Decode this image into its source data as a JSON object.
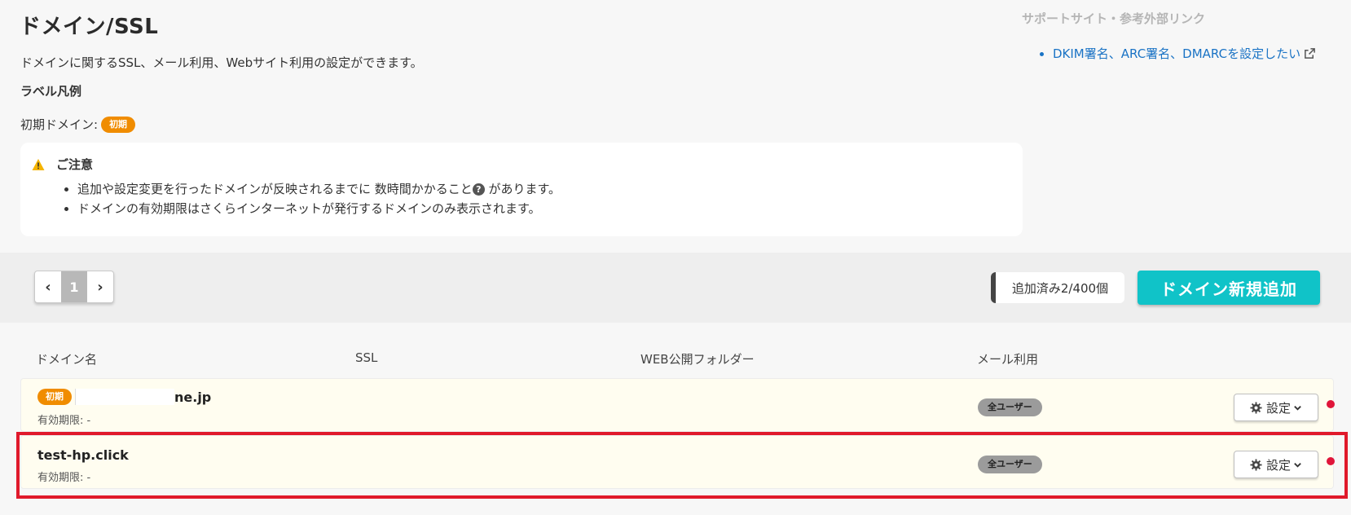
{
  "page": {
    "title": "ドメイン/SSL",
    "description": "ドメインに関するSSL、メール利用、Webサイト利用の設定ができます。",
    "legend_title": "ラベル凡例",
    "legend_label": "初期ドメイン:",
    "legend_badge": "初期"
  },
  "notice": {
    "icon": "warning-icon",
    "title": "ご注意",
    "item1_text": "追加や設定変更を行ったドメインが反映されるまでに 数時間かかること",
    "item1_suffix": " があります。",
    "item2_text": "ドメインの有効期限はさくらインターネットが発行するドメインのみ表示されます。"
  },
  "support": {
    "title": "サポートサイト・参考外部リンク",
    "link1": "DKIM署名、ARC署名、DMARCを設定したい"
  },
  "toolbar": {
    "prev": "‹",
    "page": "1",
    "next": "›",
    "count": "追加済み2/400個",
    "add_button": "ドメイン新規追加"
  },
  "table": {
    "headers": [
      "ドメイン名",
      "SSL",
      "WEB公開フォルダー",
      "メール利用"
    ],
    "rows": [
      {
        "badge": "初期",
        "domain": "ne.jp",
        "expiry": "有効期限: -",
        "mail": "全ユーザー",
        "settings": "設定"
      },
      {
        "badge": "",
        "domain": "test-hp.click",
        "expiry": "有効期限: -",
        "mail": "全ユーザー",
        "settings": "設定"
      }
    ]
  },
  "colors": {
    "accent": "#10c3c8",
    "initial_badge": "#f08c00",
    "highlight": "#e0192b",
    "link": "#1a73c5"
  }
}
